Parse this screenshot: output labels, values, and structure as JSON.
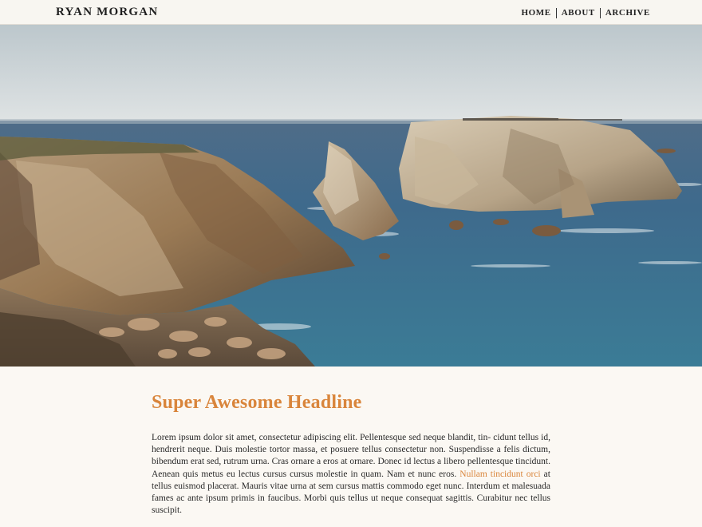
{
  "header": {
    "site_title": "RYAN MORGAN",
    "nav": [
      "HOME",
      "ABOUT",
      "ARCHIVE"
    ]
  },
  "hero": {
    "image": "coastal-rocks-photo"
  },
  "article": {
    "headline": "Super Awesome Headline",
    "body_before_link": "Lorem ipsum dolor sit amet, consectetur adipiscing elit. Pellentesque sed neque blandit, tin- cidunt tellus id, hendrerit neque. Duis molestie tortor massa, et posuere tellus consectetur non. Suspendisse a felis dictum, bibendum erat sed, rutrum urna. Cras ornare a eros at ornare. Donec id lectus a libero pellentesque tincidunt. Aenean quis metus eu lectus cursus cursus molestie in quam. Nam et nunc eros. ",
    "link_text": "Nullam tincidunt orci",
    "body_after_link": " at tellus euismod placerat. Mauris vitae urna at sem cursus mattis commodo eget nunc. Interdum et malesuada fames ac ante ipsum primis in faucibus. Morbi quis tellus ut neque consequat sagittis. Curabitur nec tellus suscipit."
  },
  "colors": {
    "accent": "#d9853b",
    "background": "#fbf8f3",
    "topbar": "#f8f6f1",
    "text": "#2a2a2a"
  }
}
